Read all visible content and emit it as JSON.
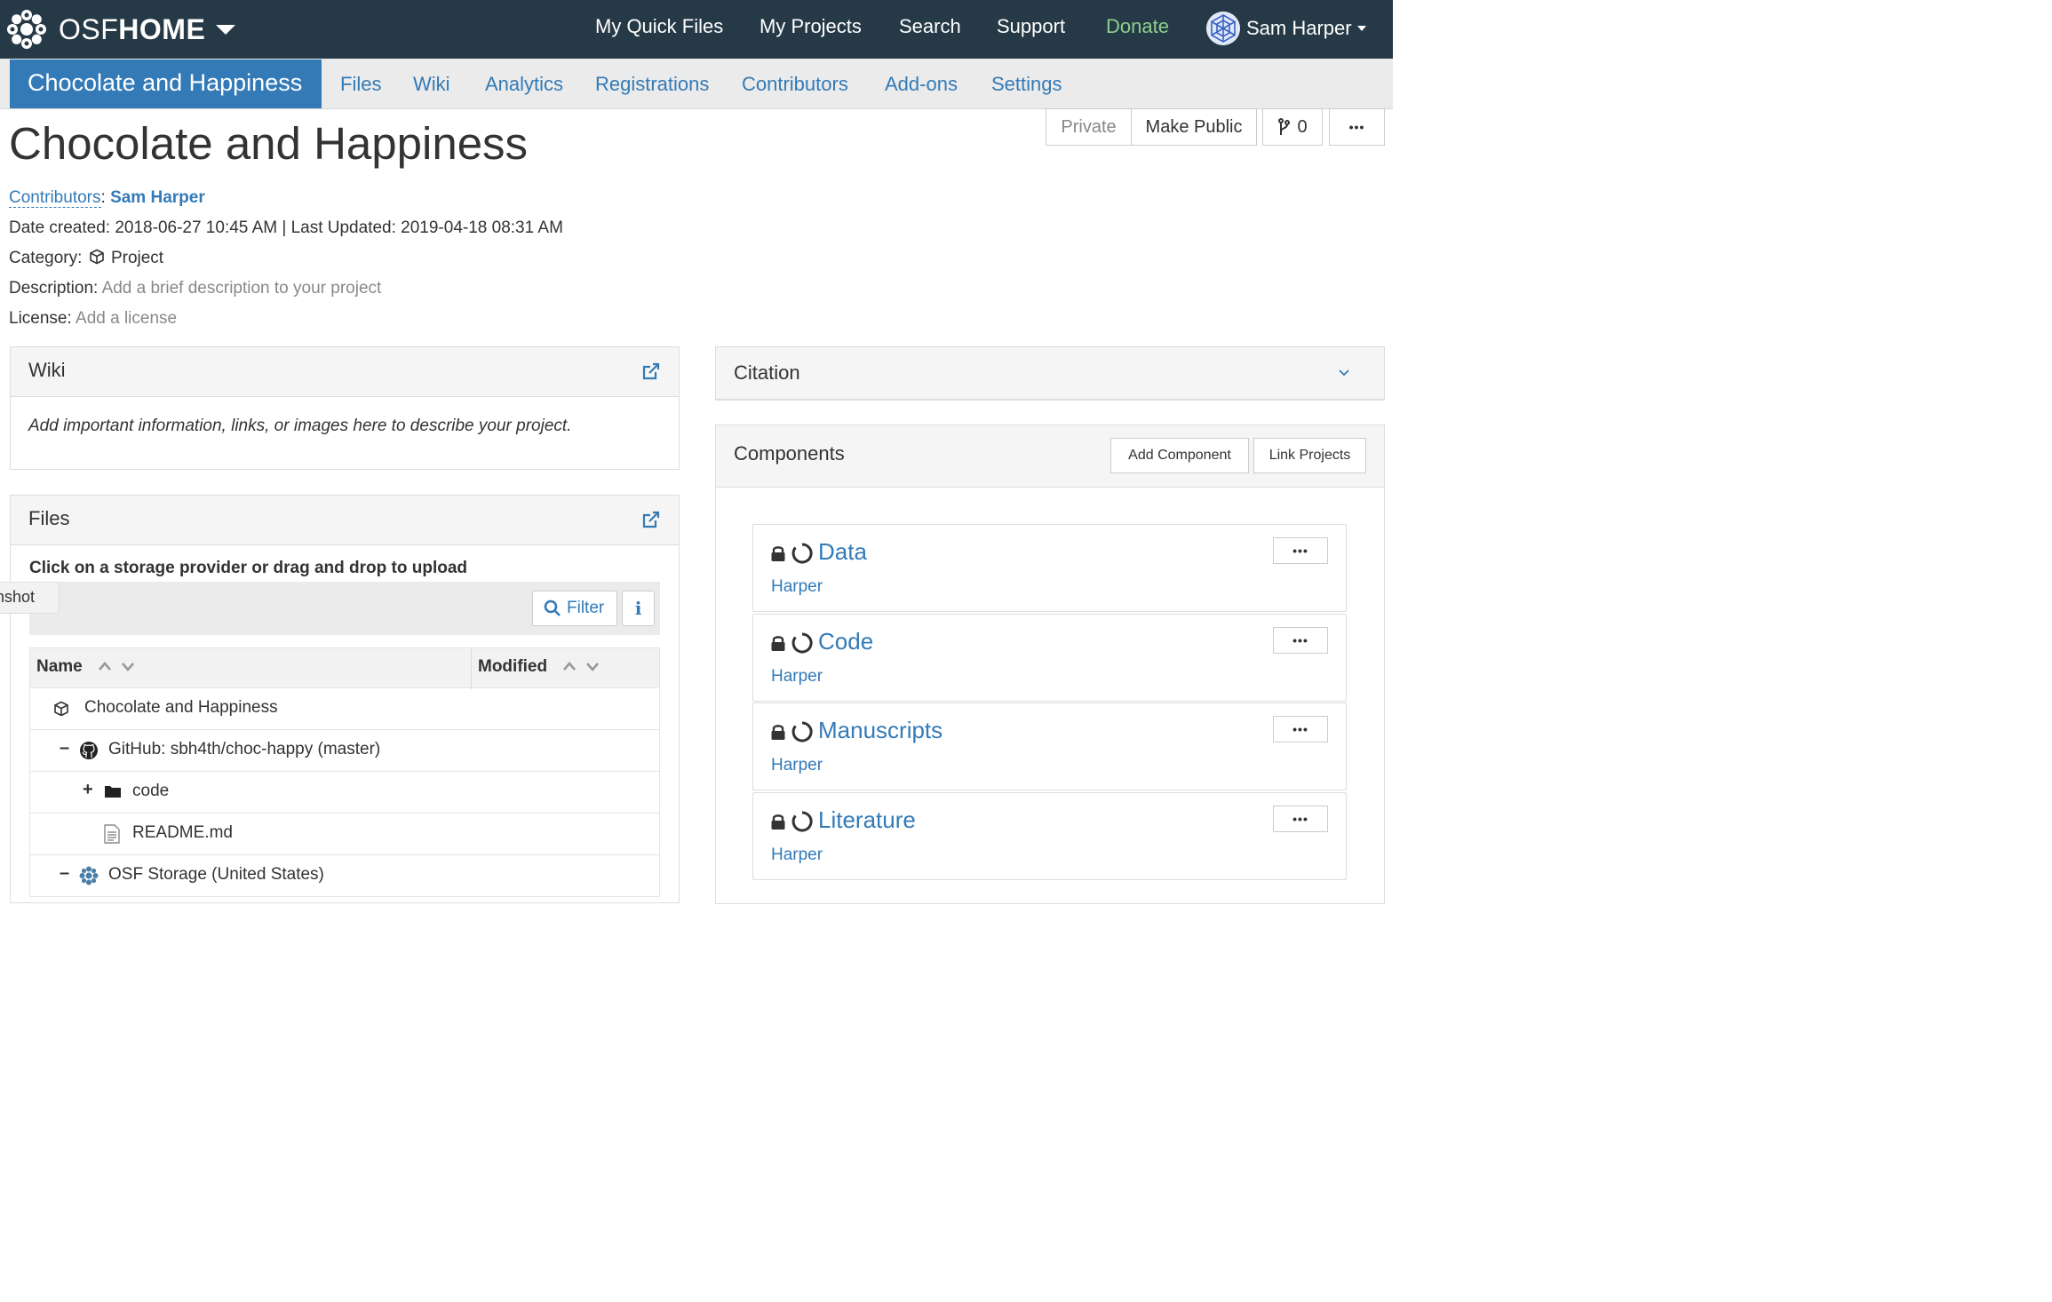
{
  "topnav": {
    "brand_light": "OSF",
    "brand_bold": "HOME",
    "links": [
      "My Quick Files",
      "My Projects",
      "Search",
      "Support",
      "Donate"
    ],
    "user_name": "Sam Harper"
  },
  "subnav": {
    "project": "Chocolate and Happiness",
    "tabs": [
      "Files",
      "Wiki",
      "Analytics",
      "Registrations",
      "Contributors",
      "Add-ons",
      "Settings"
    ]
  },
  "actions": {
    "private": "Private",
    "make_public": "Make Public",
    "forks_count": "0",
    "more": "•••"
  },
  "project": {
    "title": "Chocolate and Happiness",
    "contributors_label": "Contributors",
    "contributors_sep": ":",
    "contributor": "Sam Harper",
    "dates": "Date created: 2018-06-27 10:45 AM | Last Updated: 2019-04-18 08:31 AM",
    "category_label": "Category:",
    "category": "Project",
    "description_label": "Description:",
    "description_placeholder": "Add a brief description to your project",
    "license_label": "License:",
    "license_placeholder": "Add a license"
  },
  "wiki": {
    "title": "Wiki",
    "placeholder": "Add important information, links, or images here to describe your project."
  },
  "files": {
    "title": "Files",
    "instruction": "Click on a storage provider or drag and drop to upload",
    "filter_label": "Filter",
    "info_label": "i",
    "col_name": "Name",
    "col_modified": "Modified",
    "rows": [
      {
        "toggle": "",
        "label": "Chocolate and Happiness"
      },
      {
        "toggle": "–",
        "label": "GitHub: sbh4th/choc-happy (master)"
      },
      {
        "toggle": "+",
        "label": "code"
      },
      {
        "toggle": "",
        "label": "README.md"
      },
      {
        "toggle": "–",
        "label": "OSF Storage (United States)"
      }
    ]
  },
  "screenshot_tab": "nshot",
  "citation": {
    "title": "Citation"
  },
  "components": {
    "title": "Components",
    "add_label": "Add Component",
    "link_label": "Link Projects",
    "items": [
      {
        "name": "Data",
        "owner": "Harper",
        "more": "•••"
      },
      {
        "name": "Code",
        "owner": "Harper",
        "more": "•••"
      },
      {
        "name": "Manuscripts",
        "owner": "Harper",
        "more": "•••"
      },
      {
        "name": "Literature",
        "owner": "Harper",
        "more": "•••"
      }
    ]
  },
  "colors": {
    "navbar": "#263947",
    "accent": "#337ab7",
    "donate": "#8fcf8d"
  }
}
